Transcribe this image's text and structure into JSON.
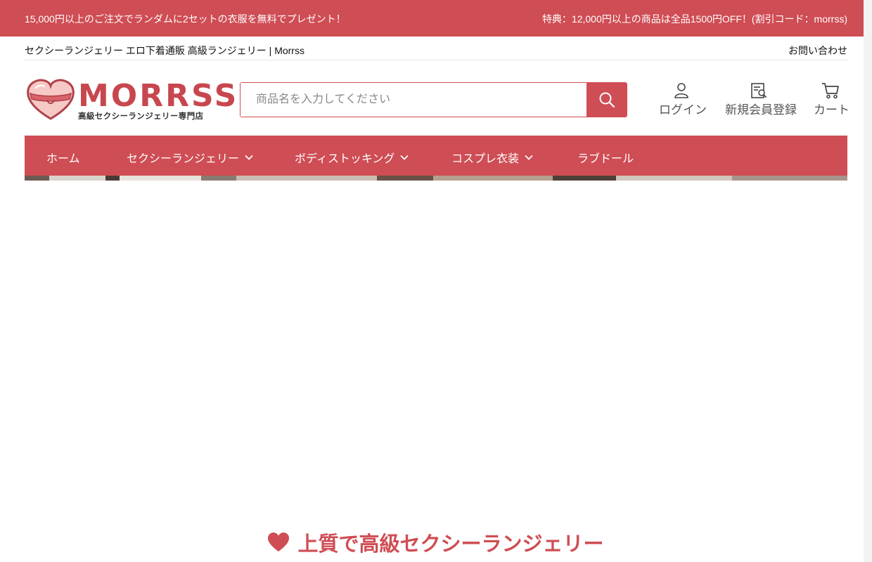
{
  "announcement": {
    "left": "15,000円以上のご注文でランダムに2セットの衣服を無料でプレゼント！",
    "right": "特典：12,000円以上の商品は全品1500円OFF！(割引コード：morrss)"
  },
  "subheader": {
    "site_title": "セクシーランジェリー エロ下着通販 高級ランジェリー | Morrss",
    "contact": "お問い合わせ"
  },
  "logo": {
    "wordmark": "MORRSS",
    "tagline": "高級セクシーランジェリー専門店",
    "icon": "heart-lingerie-icon"
  },
  "search": {
    "placeholder": "商品名を入力してください",
    "icon": "search-icon"
  },
  "account": {
    "login": "ログイン",
    "register": "新規会員登録",
    "cart": "カート"
  },
  "nav": {
    "items": [
      {
        "label": "ホーム",
        "dropdown": false
      },
      {
        "label": "セクシーランジェリー",
        "dropdown": true
      },
      {
        "label": "ボディストッキング",
        "dropdown": true
      },
      {
        "label": "コスプレ衣装",
        "dropdown": true
      },
      {
        "label": "ラブドール",
        "dropdown": false
      }
    ]
  },
  "section": {
    "title": "上質で高級セクシーランジェリー",
    "icon": "heart-icon"
  },
  "colors": {
    "brand": "#cf4d54",
    "text": "#222222"
  }
}
